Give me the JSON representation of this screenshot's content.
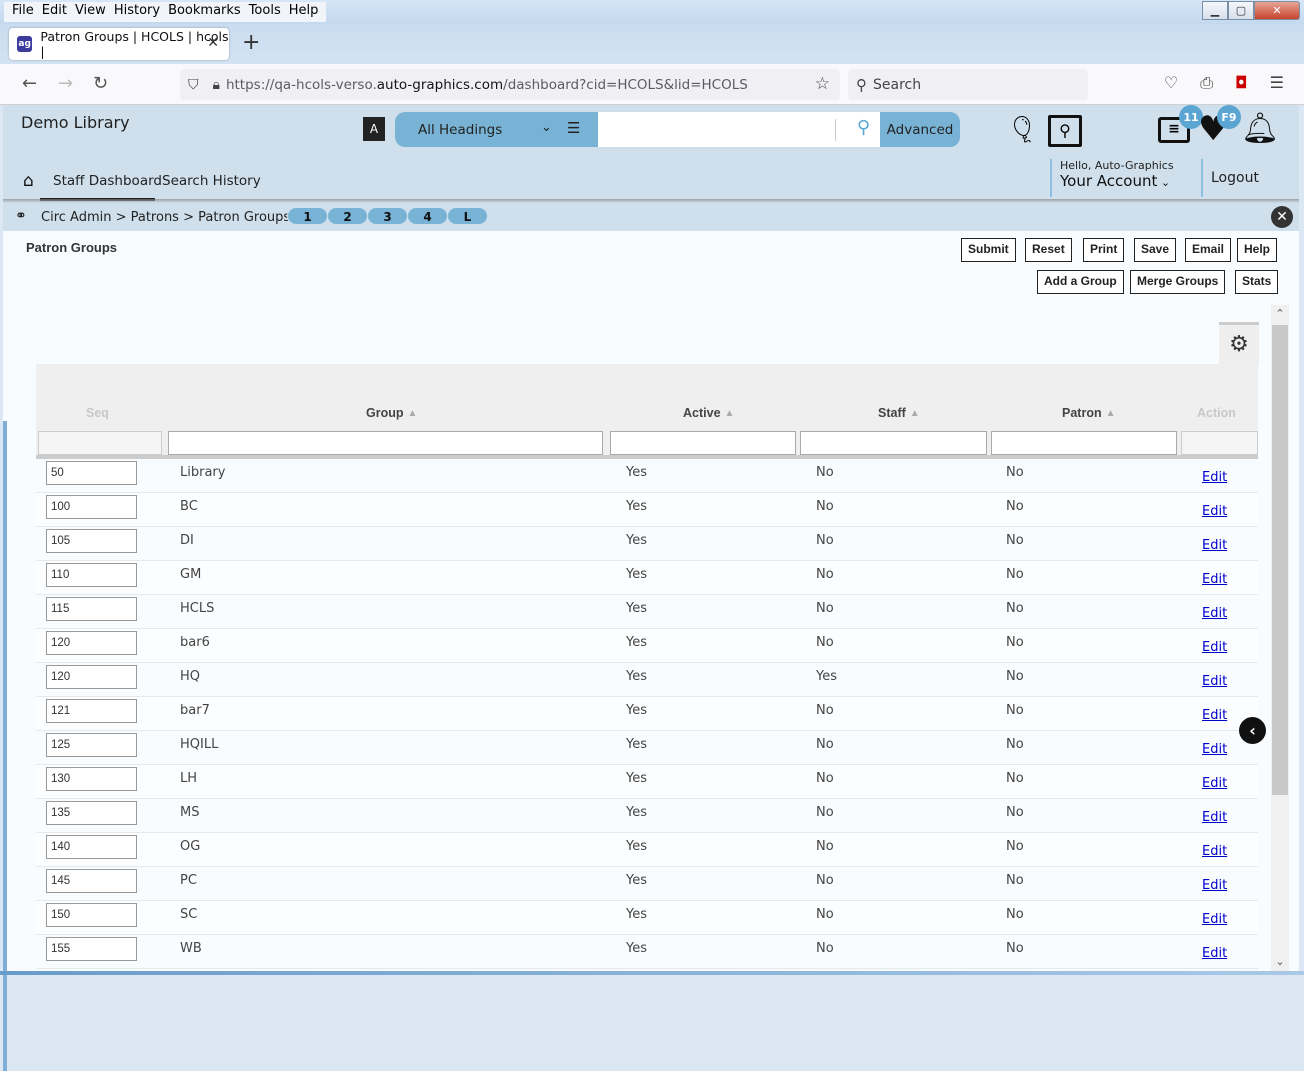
{
  "browser": {
    "menu": [
      "File",
      "Edit",
      "View",
      "History",
      "Bookmarks",
      "Tools",
      "Help"
    ],
    "tab_title": "Patron Groups | HCOLS | hcols |",
    "tab_favicon": "ag",
    "url_prefix": "https://qa-hcols-verso.",
    "url_domain": "auto-graphics.com",
    "url_suffix": "/dashboard?cid=HCOLS&lid=HCOLS",
    "search_placeholder": "Search"
  },
  "header": {
    "library_name": "Demo Library",
    "heading_select": "All Headings",
    "search_value": "",
    "advanced_label": "Advanced",
    "list_badge": "11",
    "heart_badge": "F9",
    "greeting": "Hello, Auto-Graphics",
    "account_label": "Your Account",
    "logout_label": "Logout"
  },
  "nav": {
    "items": [
      "Staff Dashboard",
      "Search History"
    ],
    "active": "Staff Dashboard"
  },
  "breadcrumb": {
    "path": "Circ Admin > Patrons > Patron Groups",
    "pages": [
      "1",
      "2",
      "3",
      "4",
      "L"
    ]
  },
  "page": {
    "title": "Patron Groups",
    "buttons_row1": [
      "Submit",
      "Reset",
      "Print",
      "Save",
      "Email",
      "Help"
    ],
    "buttons_row2": [
      "Add a Group",
      "Merge Groups",
      "Stats"
    ]
  },
  "table": {
    "columns": [
      "Seq",
      "Group",
      "Active",
      "Staff",
      "Patron",
      "Action"
    ],
    "edit_label": "Edit",
    "rows": [
      {
        "seq": "50",
        "group": "Library",
        "active": "Yes",
        "staff": "No",
        "patron": "No"
      },
      {
        "seq": "100",
        "group": "BC",
        "active": "Yes",
        "staff": "No",
        "patron": "No"
      },
      {
        "seq": "105",
        "group": "DI",
        "active": "Yes",
        "staff": "No",
        "patron": "No"
      },
      {
        "seq": "110",
        "group": "GM",
        "active": "Yes",
        "staff": "No",
        "patron": "No"
      },
      {
        "seq": "115",
        "group": "HCLS",
        "active": "Yes",
        "staff": "No",
        "patron": "No"
      },
      {
        "seq": "120",
        "group": "bar6",
        "active": "Yes",
        "staff": "No",
        "patron": "No"
      },
      {
        "seq": "120",
        "group": "HQ",
        "active": "Yes",
        "staff": "Yes",
        "patron": "No"
      },
      {
        "seq": "121",
        "group": "bar7",
        "active": "Yes",
        "staff": "No",
        "patron": "No"
      },
      {
        "seq": "125",
        "group": "HQILL",
        "active": "Yes",
        "staff": "No",
        "patron": "No"
      },
      {
        "seq": "130",
        "group": "LH",
        "active": "Yes",
        "staff": "No",
        "patron": "No"
      },
      {
        "seq": "135",
        "group": "MS",
        "active": "Yes",
        "staff": "No",
        "patron": "No"
      },
      {
        "seq": "140",
        "group": "OG",
        "active": "Yes",
        "staff": "No",
        "patron": "No"
      },
      {
        "seq": "145",
        "group": "PC",
        "active": "Yes",
        "staff": "No",
        "patron": "No"
      },
      {
        "seq": "150",
        "group": "SC",
        "active": "Yes",
        "staff": "No",
        "patron": "No"
      },
      {
        "seq": "155",
        "group": "WB",
        "active": "Yes",
        "staff": "No",
        "patron": "No"
      }
    ]
  },
  "colors": {
    "accent": "#78b3d6",
    "header_bg": "#cfe0ec",
    "link": "#0000cc"
  }
}
